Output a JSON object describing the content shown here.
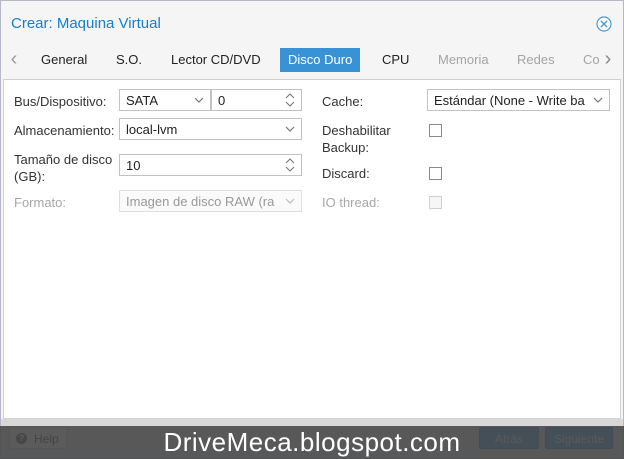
{
  "window": {
    "title": "Crear: Maquina Virtual",
    "close_icon": "close-circle-icon"
  },
  "tabs": [
    {
      "label": "General",
      "state": "normal"
    },
    {
      "label": "S.O.",
      "state": "normal"
    },
    {
      "label": "Lector CD/DVD",
      "state": "normal"
    },
    {
      "label": "Disco Duro",
      "state": "active"
    },
    {
      "label": "CPU",
      "state": "normal"
    },
    {
      "label": "Memoria",
      "state": "disabled"
    },
    {
      "label": "Redes",
      "state": "disabled"
    },
    {
      "label": "Co",
      "state": "disabled"
    }
  ],
  "form": {
    "bus_label": "Bus/Dispositivo:",
    "bus_value": "SATA",
    "device_value": "0",
    "storage_label": "Almacenamiento:",
    "storage_value": "local-lvm",
    "size_label": "Tamaño de disco (GB):",
    "size_value": "10",
    "format_label": "Formato:",
    "format_value": "Imagen de disco RAW (ra",
    "cache_label": "Cache:",
    "cache_value": "Estándar (None - Write ba",
    "backup_label": "Deshabilitar Backup:",
    "backup_checked": false,
    "discard_label": "Discard:",
    "discard_checked": false,
    "iothread_label": "IO thread:",
    "iothread_checked": false
  },
  "footer": {
    "help_label": "Help",
    "back_label": "Atrás",
    "next_label": "Siguiente"
  },
  "watermark": "DriveMeca.blogspot.com",
  "colors": {
    "accent": "#3892d4",
    "title": "#157fcc",
    "disabled_text": "#a4a4a4"
  }
}
